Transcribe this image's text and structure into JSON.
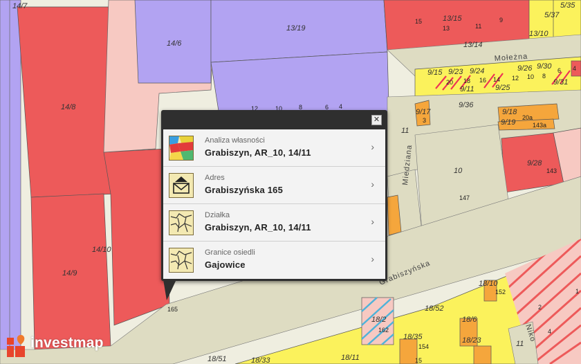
{
  "popup": {
    "close_symbol": "✕",
    "rows": [
      {
        "category": "Analiza własności",
        "value": "Grabiszyn, AR_10, 14/11",
        "icon": "ownership-map-icon"
      },
      {
        "category": "Adres",
        "value": "Grabiszyńska 165",
        "icon": "address-envelope-icon"
      },
      {
        "category": "Działka",
        "value": "Grabiszyn, AR_10, 14/11",
        "icon": "parcel-map-icon"
      },
      {
        "category": "Granice osiedli",
        "value": "Gajowice",
        "icon": "district-boundary-icon"
      }
    ],
    "chevron": "›"
  },
  "logo": {
    "text": "investmap"
  },
  "map": {
    "streets": [
      "Mołeżna",
      "Miedziana",
      "Grabiszyńska",
      "Niko"
    ],
    "plot_labels": [
      "14/7",
      "14/6",
      "13/19",
      "14/8",
      "14/10",
      "14/9",
      "13/15",
      "13/14",
      "13/10",
      "5/37",
      "5/35",
      "9/15",
      "9/23",
      "9/24",
      "9/26",
      "9/30",
      "9/11",
      "9/25",
      "9/31",
      "9/36",
      "9/17",
      "9/18",
      "9/19",
      "9/28",
      "10",
      "11",
      "18/10",
      "18/52",
      "18/2",
      "18/6",
      "18/35",
      "18/23",
      "18/51",
      "18/33",
      "18/11",
      "11"
    ],
    "numbers": [
      "15",
      "13",
      "11",
      "9",
      "12",
      "10",
      "8",
      "6",
      "4",
      "20",
      "18",
      "16",
      "14",
      "12",
      "10",
      "8",
      "6",
      "4",
      "3",
      "20a",
      "143a",
      "143",
      "147",
      "165",
      "152",
      "162",
      "154",
      "2",
      "4",
      "1",
      "15"
    ],
    "colors": {
      "residential": "#b2a3f2",
      "commercial": "#ed5a5a",
      "light_red": "#f7c9c2",
      "yellow": "#fbf25c",
      "road": "#dedcc2",
      "orange": "#f5a63c"
    }
  }
}
